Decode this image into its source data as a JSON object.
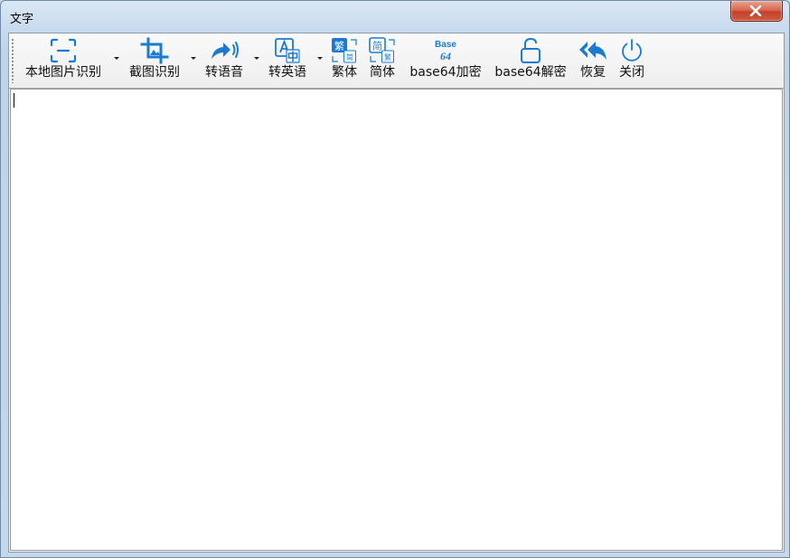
{
  "window": {
    "title": "文字",
    "close_icon": "close-x-icon"
  },
  "toolbar": {
    "buttons": [
      {
        "label": "本地图片识别",
        "icon": "scan-icon",
        "has_dropdown": true
      },
      {
        "label": "截图识别",
        "icon": "crop-icon",
        "has_dropdown": true
      },
      {
        "label": "转语音",
        "icon": "speech-forward-icon",
        "has_dropdown": true
      },
      {
        "label": "转英语",
        "icon": "translate-icon",
        "has_dropdown": true
      },
      {
        "label": "繁体",
        "icon": "traditional-chinese-icon",
        "icon_text_main": "繁",
        "icon_text_sub": "简"
      },
      {
        "label": "简体",
        "icon": "simplified-chinese-icon",
        "icon_text_main": "简",
        "icon_text_sub": "繁"
      },
      {
        "label": "base64加密",
        "icon": "base64-icon",
        "icon_text_top": "Base",
        "icon_text_bottom": "64"
      },
      {
        "label": "base64解密",
        "icon": "unlock-icon"
      },
      {
        "label": "恢复",
        "icon": "reply-all-icon"
      },
      {
        "label": "关闭",
        "icon": "power-icon"
      }
    ]
  },
  "editor": {
    "value": ""
  },
  "colors": {
    "accent": "#1a7bd1",
    "close_red": "#c4412a"
  }
}
